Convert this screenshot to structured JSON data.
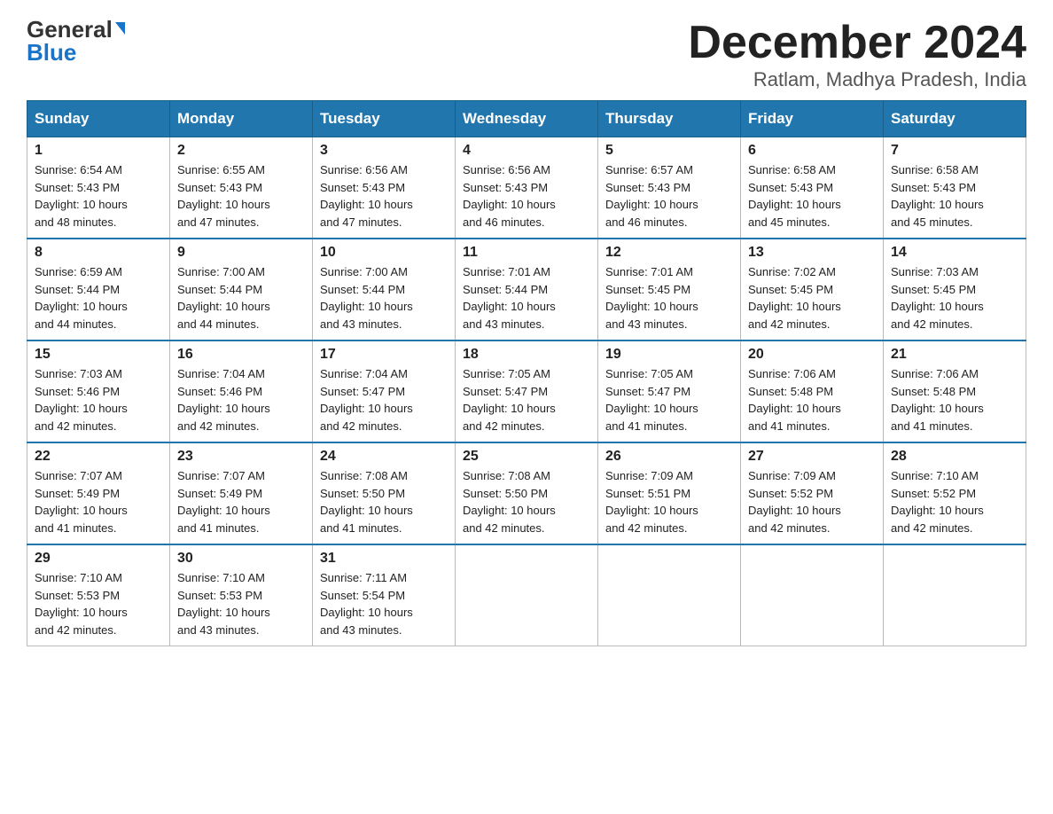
{
  "header": {
    "logo_general": "General",
    "logo_blue": "Blue",
    "month_title": "December 2024",
    "subtitle": "Ratlam, Madhya Pradesh, India"
  },
  "days_of_week": [
    "Sunday",
    "Monday",
    "Tuesday",
    "Wednesday",
    "Thursday",
    "Friday",
    "Saturday"
  ],
  "weeks": [
    [
      {
        "day": "1",
        "sunrise": "6:54 AM",
        "sunset": "5:43 PM",
        "daylight": "10 hours and 48 minutes."
      },
      {
        "day": "2",
        "sunrise": "6:55 AM",
        "sunset": "5:43 PM",
        "daylight": "10 hours and 47 minutes."
      },
      {
        "day": "3",
        "sunrise": "6:56 AM",
        "sunset": "5:43 PM",
        "daylight": "10 hours and 47 minutes."
      },
      {
        "day": "4",
        "sunrise": "6:56 AM",
        "sunset": "5:43 PM",
        "daylight": "10 hours and 46 minutes."
      },
      {
        "day": "5",
        "sunrise": "6:57 AM",
        "sunset": "5:43 PM",
        "daylight": "10 hours and 46 minutes."
      },
      {
        "day": "6",
        "sunrise": "6:58 AM",
        "sunset": "5:43 PM",
        "daylight": "10 hours and 45 minutes."
      },
      {
        "day": "7",
        "sunrise": "6:58 AM",
        "sunset": "5:43 PM",
        "daylight": "10 hours and 45 minutes."
      }
    ],
    [
      {
        "day": "8",
        "sunrise": "6:59 AM",
        "sunset": "5:44 PM",
        "daylight": "10 hours and 44 minutes."
      },
      {
        "day": "9",
        "sunrise": "7:00 AM",
        "sunset": "5:44 PM",
        "daylight": "10 hours and 44 minutes."
      },
      {
        "day": "10",
        "sunrise": "7:00 AM",
        "sunset": "5:44 PM",
        "daylight": "10 hours and 43 minutes."
      },
      {
        "day": "11",
        "sunrise": "7:01 AM",
        "sunset": "5:44 PM",
        "daylight": "10 hours and 43 minutes."
      },
      {
        "day": "12",
        "sunrise": "7:01 AM",
        "sunset": "5:45 PM",
        "daylight": "10 hours and 43 minutes."
      },
      {
        "day": "13",
        "sunrise": "7:02 AM",
        "sunset": "5:45 PM",
        "daylight": "10 hours and 42 minutes."
      },
      {
        "day": "14",
        "sunrise": "7:03 AM",
        "sunset": "5:45 PM",
        "daylight": "10 hours and 42 minutes."
      }
    ],
    [
      {
        "day": "15",
        "sunrise": "7:03 AM",
        "sunset": "5:46 PM",
        "daylight": "10 hours and 42 minutes."
      },
      {
        "day": "16",
        "sunrise": "7:04 AM",
        "sunset": "5:46 PM",
        "daylight": "10 hours and 42 minutes."
      },
      {
        "day": "17",
        "sunrise": "7:04 AM",
        "sunset": "5:47 PM",
        "daylight": "10 hours and 42 minutes."
      },
      {
        "day": "18",
        "sunrise": "7:05 AM",
        "sunset": "5:47 PM",
        "daylight": "10 hours and 42 minutes."
      },
      {
        "day": "19",
        "sunrise": "7:05 AM",
        "sunset": "5:47 PM",
        "daylight": "10 hours and 41 minutes."
      },
      {
        "day": "20",
        "sunrise": "7:06 AM",
        "sunset": "5:48 PM",
        "daylight": "10 hours and 41 minutes."
      },
      {
        "day": "21",
        "sunrise": "7:06 AM",
        "sunset": "5:48 PM",
        "daylight": "10 hours and 41 minutes."
      }
    ],
    [
      {
        "day": "22",
        "sunrise": "7:07 AM",
        "sunset": "5:49 PM",
        "daylight": "10 hours and 41 minutes."
      },
      {
        "day": "23",
        "sunrise": "7:07 AM",
        "sunset": "5:49 PM",
        "daylight": "10 hours and 41 minutes."
      },
      {
        "day": "24",
        "sunrise": "7:08 AM",
        "sunset": "5:50 PM",
        "daylight": "10 hours and 41 minutes."
      },
      {
        "day": "25",
        "sunrise": "7:08 AM",
        "sunset": "5:50 PM",
        "daylight": "10 hours and 42 minutes."
      },
      {
        "day": "26",
        "sunrise": "7:09 AM",
        "sunset": "5:51 PM",
        "daylight": "10 hours and 42 minutes."
      },
      {
        "day": "27",
        "sunrise": "7:09 AM",
        "sunset": "5:52 PM",
        "daylight": "10 hours and 42 minutes."
      },
      {
        "day": "28",
        "sunrise": "7:10 AM",
        "sunset": "5:52 PM",
        "daylight": "10 hours and 42 minutes."
      }
    ],
    [
      {
        "day": "29",
        "sunrise": "7:10 AM",
        "sunset": "5:53 PM",
        "daylight": "10 hours and 42 minutes."
      },
      {
        "day": "30",
        "sunrise": "7:10 AM",
        "sunset": "5:53 PM",
        "daylight": "10 hours and 43 minutes."
      },
      {
        "day": "31",
        "sunrise": "7:11 AM",
        "sunset": "5:54 PM",
        "daylight": "10 hours and 43 minutes."
      },
      null,
      null,
      null,
      null
    ]
  ],
  "labels": {
    "sunrise": "Sunrise:",
    "sunset": "Sunset:",
    "daylight": "Daylight:"
  }
}
